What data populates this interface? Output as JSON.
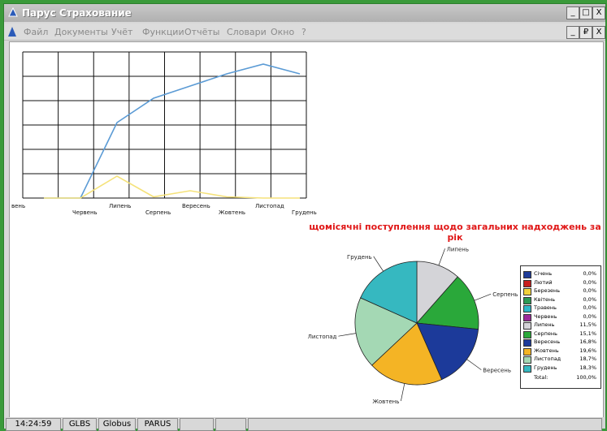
{
  "window": {
    "title": "Парус Страхование",
    "buttons": [
      "_",
      "□",
      "X"
    ],
    "doc_buttons": [
      "_",
      "₽",
      "X"
    ]
  },
  "menu": [
    "Файл",
    "Документы",
    "Учёт",
    "Функции",
    "Отчёты",
    "Словари",
    "Окно",
    "?"
  ],
  "status": {
    "time": "14:24:59",
    "cells": [
      "GLBS",
      "Globus",
      "PARUS"
    ]
  },
  "chart_data": [
    {
      "type": "line",
      "x": [
        "...вень",
        "Червень",
        "Липень",
        "Серпень",
        "Вересень",
        "Жовтень",
        "Листопад",
        "Грудень"
      ],
      "x_tick_labels": [
        "вень",
        "Червень",
        "Липень",
        "Серпень",
        "Вересень",
        "Жовтень",
        "Листопад",
        "Грудень"
      ],
      "series": [
        {
          "color": "#5b9bd5",
          "values": [
            0,
            0,
            3.1,
            4.1,
            4.6,
            5.1,
            5.5,
            5.1
          ]
        },
        {
          "color": "#f5e27a",
          "values": [
            0,
            0,
            0.9,
            0.05,
            0.3,
            0.05,
            0,
            0
          ]
        }
      ],
      "ylim": [
        0,
        6
      ],
      "grid": true
    },
    {
      "type": "pie",
      "title": "щомісячні поступлення щодо загальних надходжень за рік",
      "slices": [
        {
          "name": "Січень",
          "value": 0.0,
          "label": "0,0%",
          "color": "#1f3c99"
        },
        {
          "name": "Лютий",
          "value": 0.0,
          "label": "0,0%",
          "color": "#c81e1e"
        },
        {
          "name": "Березень",
          "value": 0.0,
          "label": "0,0%",
          "color": "#f2d23c"
        },
        {
          "name": "Квітень",
          "value": 0.0,
          "label": "0,0%",
          "color": "#2a9a55"
        },
        {
          "name": "Травень",
          "value": 0.0,
          "label": "0,0%",
          "color": "#2eb8c8"
        },
        {
          "name": "Червень",
          "value": 0.0,
          "label": "0,0%",
          "color": "#9c2a9c"
        },
        {
          "name": "Липень",
          "value": 11.5,
          "label": "11,5%",
          "color": "#d4d4d8"
        },
        {
          "name": "Серпень",
          "value": 15.1,
          "label": "15,1%",
          "color": "#2aa83a"
        },
        {
          "name": "Вересень",
          "value": 16.8,
          "label": "16,8%",
          "color": "#1c3a9a"
        },
        {
          "name": "Жовтень",
          "value": 19.6,
          "label": "19,6%",
          "color": "#f4b425"
        },
        {
          "name": "Листопад",
          "value": 18.7,
          "label": "18,7%",
          "color": "#a4d8b4"
        },
        {
          "name": "Грудень",
          "value": 18.3,
          "label": "18,3%",
          "color": "#36b8c0"
        }
      ],
      "total_label": "Total:",
      "total_value": "100,0%",
      "legend": "right"
    }
  ]
}
